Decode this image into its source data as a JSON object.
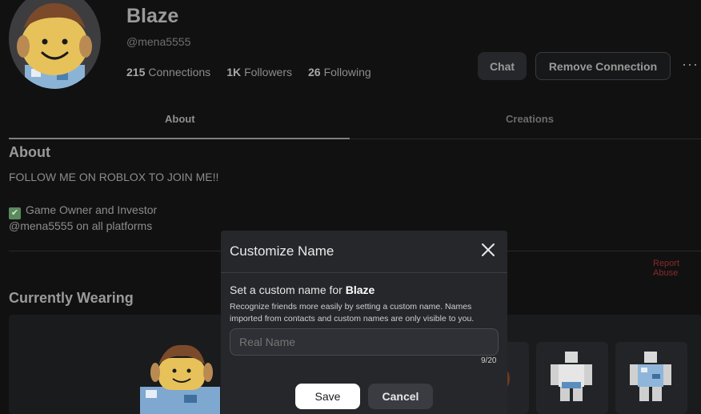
{
  "profile": {
    "display_name": "Blaze",
    "username": "@mena5555",
    "stats": [
      {
        "count": "215",
        "label": "Connections"
      },
      {
        "count": "1K",
        "label": "Followers"
      },
      {
        "count": "26",
        "label": "Following"
      }
    ],
    "chat_label": "Chat",
    "remove_label": "Remove Connection",
    "more_label": "···"
  },
  "tabs": [
    {
      "label": "About"
    },
    {
      "label": "Creations"
    }
  ],
  "about": {
    "title": "About",
    "line1": "FOLLOW ME ON ROBLOX TO JOIN ME!!",
    "line2": "Game Owner and Investor",
    "line3": "@mena5555 on all platforms",
    "check_glyph": "✔",
    "report_label": "Report Abuse"
  },
  "wearing": {
    "title": "Currently Wearing"
  },
  "modal": {
    "title": "Customize Name",
    "heading_prefix": "Set a custom name for",
    "heading_name": "Blaze",
    "description": "Recognize friends more easily by setting a custom name. Names imported from contacts and custom names are only visible to you.",
    "input_placeholder": "Real Name",
    "char_count": "9/20",
    "save_label": "Save",
    "cancel_label": "Cancel"
  },
  "colors": {
    "background": "#111112",
    "modal_bg": "#26272b",
    "report_red": "#8a2a28"
  }
}
